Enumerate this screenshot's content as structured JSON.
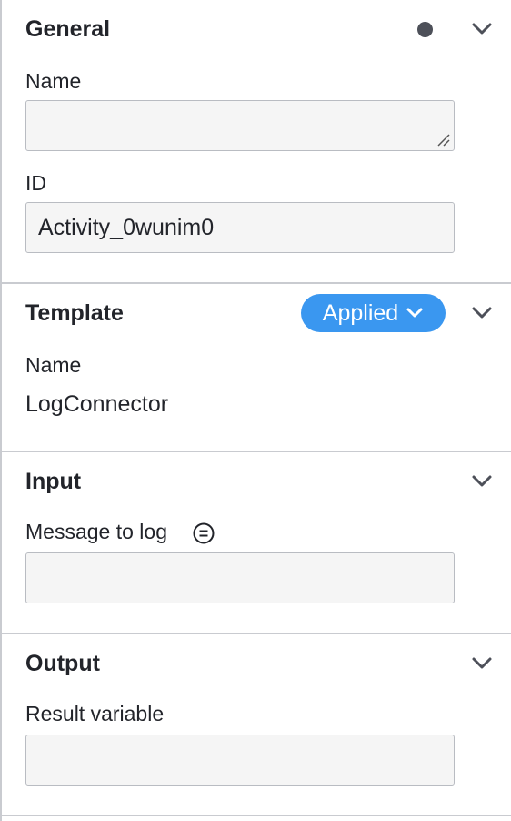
{
  "groups": {
    "general": {
      "title": "General",
      "name_label": "Name",
      "name_value": "",
      "id_label": "ID",
      "id_value": "Activity_0wunim0"
    },
    "template": {
      "title": "Template",
      "badge_label": "Applied",
      "name_label": "Name",
      "name_value": "LogConnector"
    },
    "input": {
      "title": "Input",
      "message_label": "Message to log",
      "message_value": ""
    },
    "output": {
      "title": "Output",
      "result_label": "Result variable",
      "result_value": ""
    }
  },
  "icons": {
    "chevron": "chevron-down-icon",
    "status_dot": "status-dot-icon",
    "feel": "feel-expression-icon"
  },
  "colors": {
    "accent": "#3a97f0",
    "border": "#c9cbd0",
    "text": "#22242a",
    "field_bg": "#f5f5f5"
  }
}
